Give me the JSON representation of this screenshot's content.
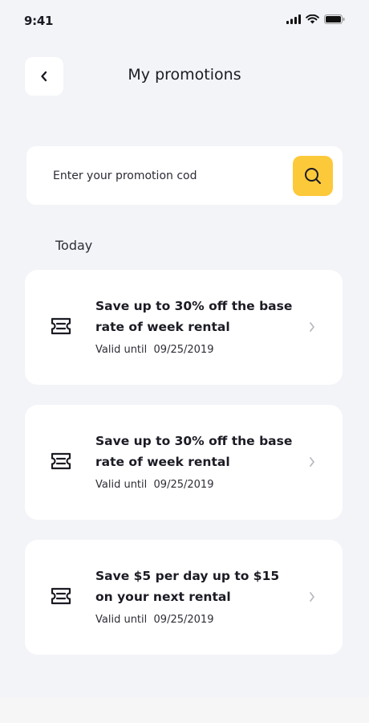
{
  "status_bar": {
    "time": "9:41",
    "icons": [
      "signal-icon",
      "wifi-icon",
      "battery-icon"
    ]
  },
  "header": {
    "back_icon": "chevron-left-icon",
    "title": "My promotions"
  },
  "search": {
    "placeholder": "Enter your promotion cod",
    "value": "",
    "button_icon": "search-icon",
    "button_color": "#fcc93a"
  },
  "section": {
    "label": "Today"
  },
  "promotions": [
    {
      "title": "Save up to 30% off the base rate of week rental",
      "valid_label": "Valid until",
      "valid_date": "09/25/2019",
      "icon": "ticket-icon"
    },
    {
      "title": "Save up to 30% off the base rate of week rental",
      "valid_label": "Valid until",
      "valid_date": "09/25/2019",
      "icon": "ticket-icon"
    },
    {
      "title": "Save $5 per day up to $15 on your next rental",
      "valid_label": "Valid until",
      "valid_date": "09/25/2019",
      "icon": "ticket-icon"
    }
  ],
  "colors": {
    "background": "#f3f4f8",
    "card": "#ffffff",
    "accent": "#fcc93a",
    "text": "#1b1b24"
  }
}
